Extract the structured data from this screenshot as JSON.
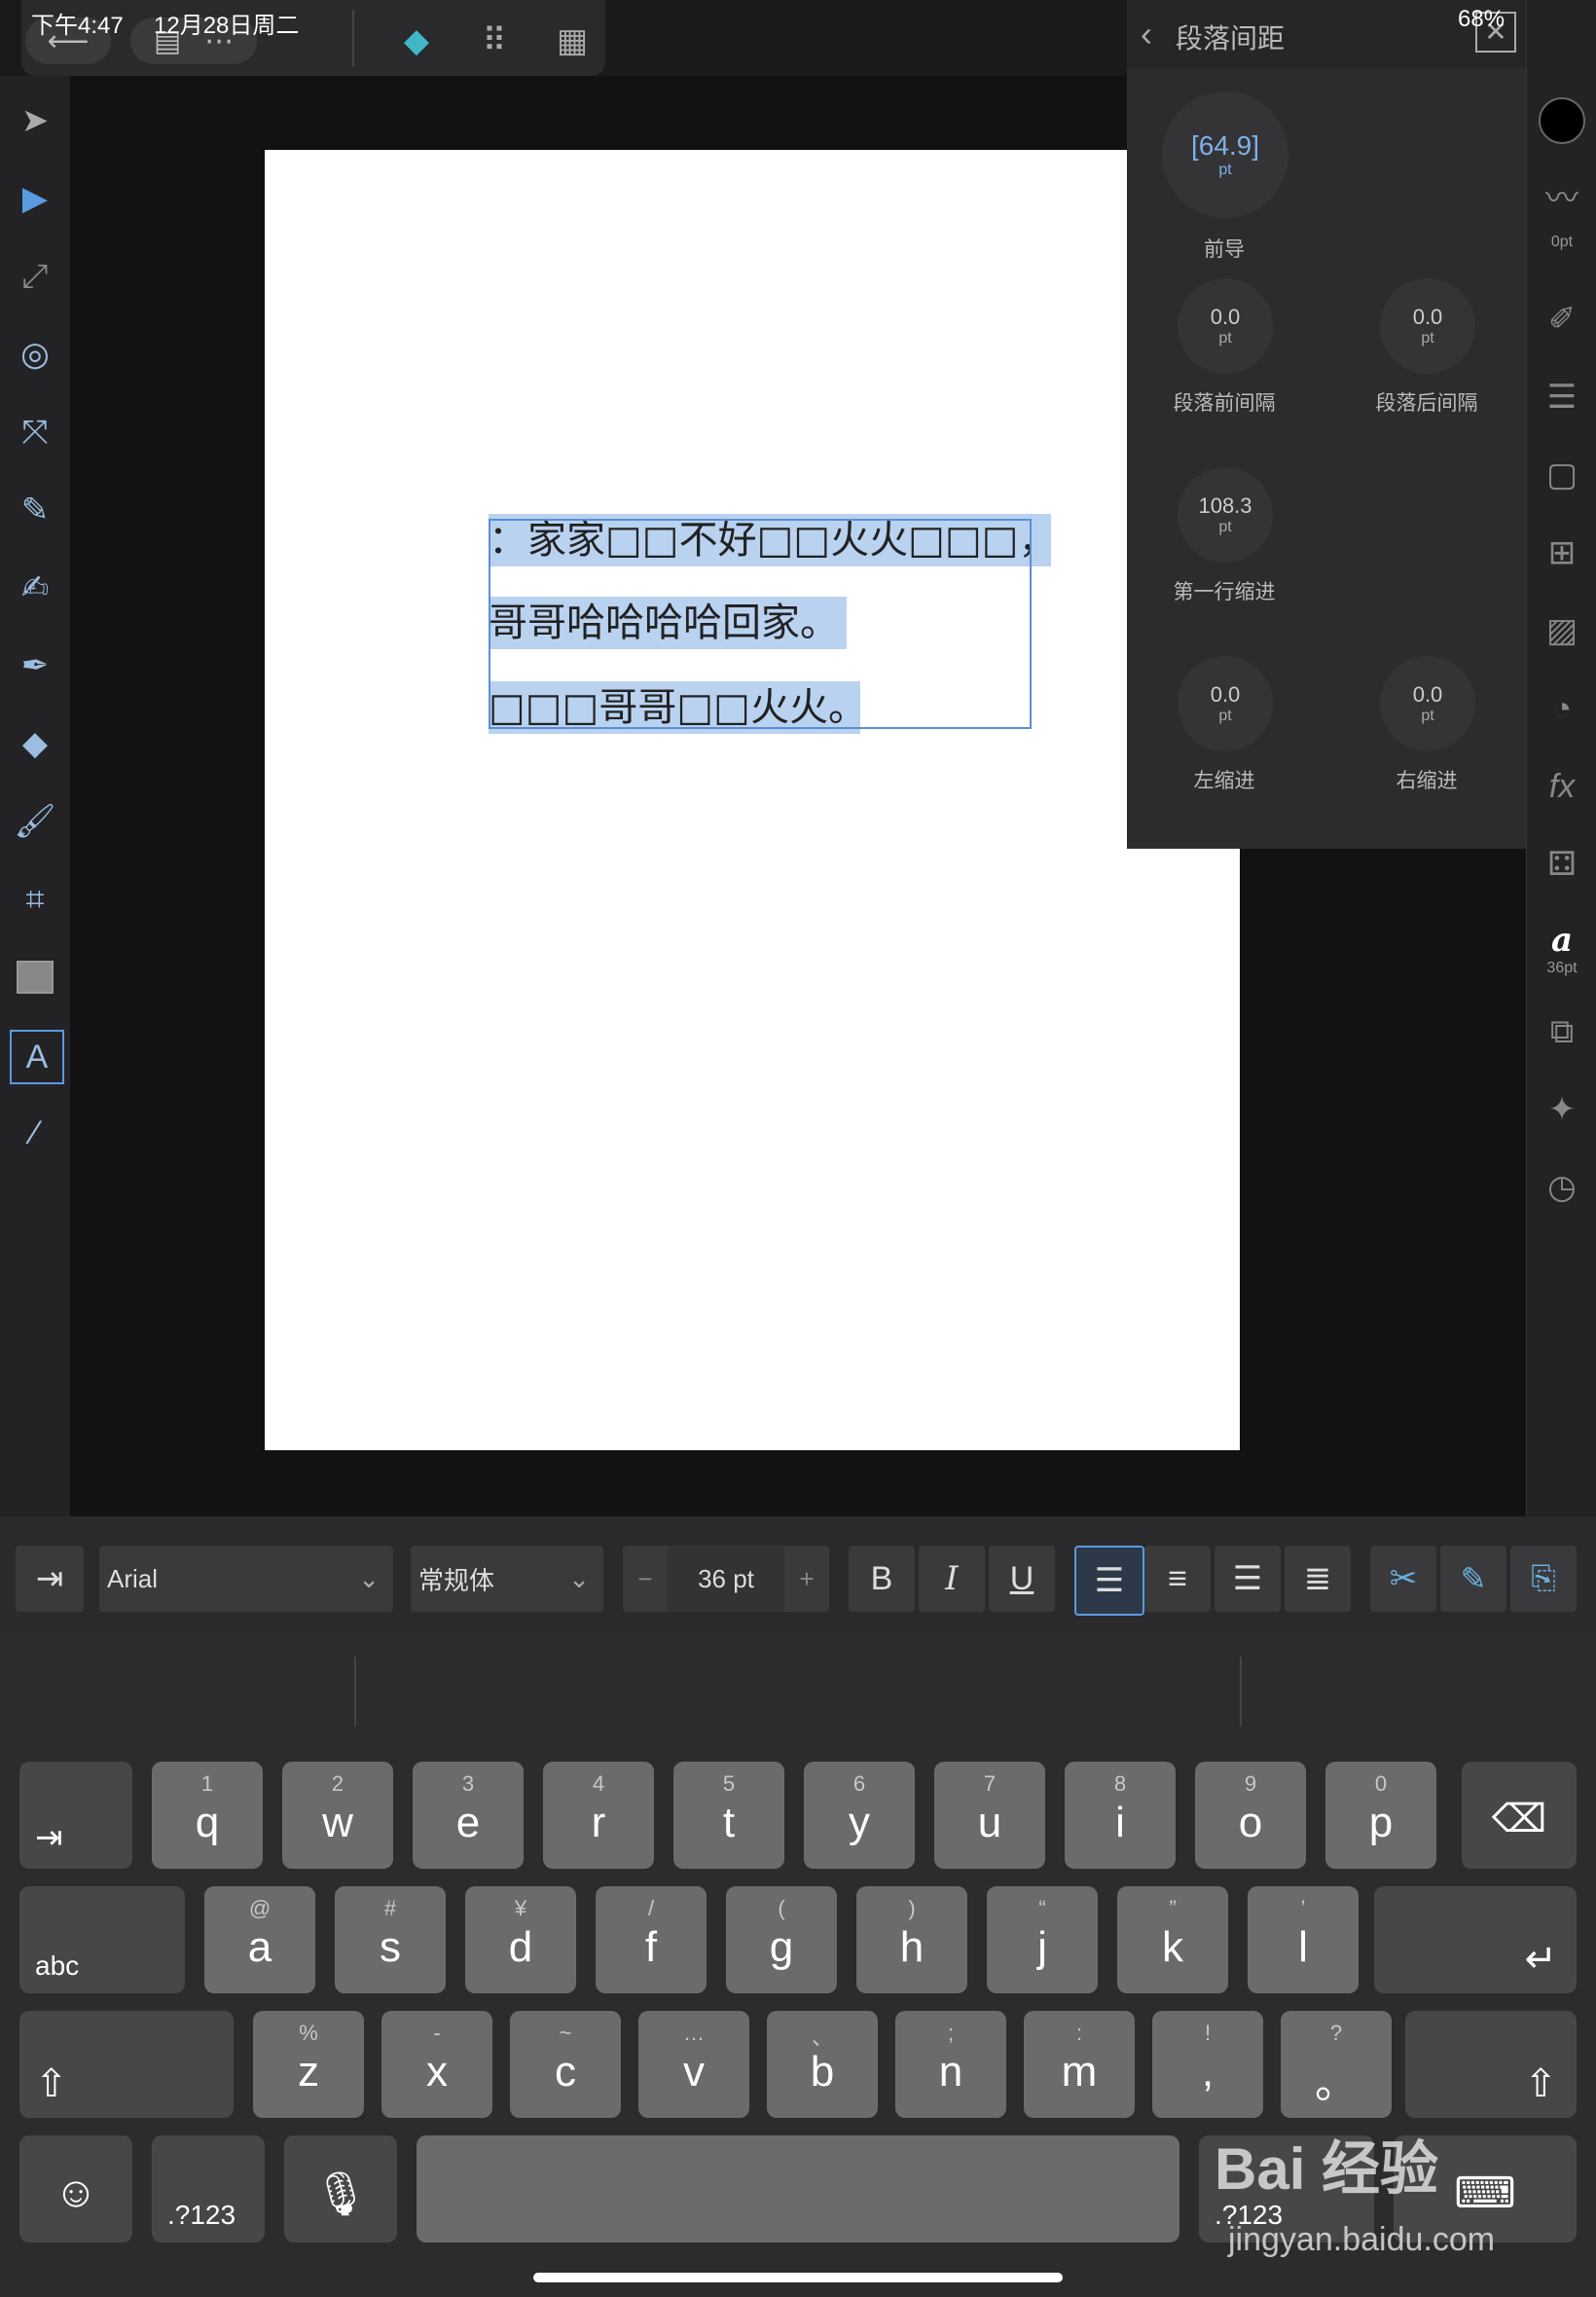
{
  "status": {
    "time": "下午4:47",
    "date": "12月28日周二",
    "battery": "68%"
  },
  "toolbar": {
    "back": "⟵",
    "doc": "▤",
    "more": "⋯"
  },
  "document": {
    "lines": [
      "：家家□□不好□□火火□□□，",
      "哥哥哈哈哈哈回家。",
      "□□□哥哥□□火火。"
    ]
  },
  "panel": {
    "title": "段落间距",
    "leading": {
      "value": "[64.9]",
      "unit": "pt",
      "label": "前导"
    },
    "space_before": {
      "value": "0.0",
      "unit": "pt",
      "label": "段落前间隔"
    },
    "space_after": {
      "value": "0.0",
      "unit": "pt",
      "label": "段落后间隔"
    },
    "first_indent": {
      "value": "108.3",
      "unit": "pt",
      "label": "第一行缩进"
    },
    "left_indent": {
      "value": "0.0",
      "unit": "pt",
      "label": "左缩进"
    },
    "right_indent": {
      "value": "0.0",
      "unit": "pt",
      "label": "右缩进"
    }
  },
  "studio": {
    "stroke_width": "0pt",
    "font_size": "36pt"
  },
  "format": {
    "font": "Arial",
    "style": "常规体",
    "size": "36 pt",
    "minus": "−",
    "plus": "+",
    "bold": "B",
    "italic": "I",
    "underline": "U"
  },
  "keyboard": {
    "row1": [
      {
        "h": "1",
        "c": "q"
      },
      {
        "h": "2",
        "c": "w"
      },
      {
        "h": "3",
        "c": "e"
      },
      {
        "h": "4",
        "c": "r"
      },
      {
        "h": "5",
        "c": "t"
      },
      {
        "h": "6",
        "c": "y"
      },
      {
        "h": "7",
        "c": "u"
      },
      {
        "h": "8",
        "c": "i"
      },
      {
        "h": "9",
        "c": "o"
      },
      {
        "h": "0",
        "c": "p"
      }
    ],
    "row2": [
      {
        "h": "@",
        "c": "a"
      },
      {
        "h": "#",
        "c": "s"
      },
      {
        "h": "¥",
        "c": "d"
      },
      {
        "h": "/",
        "c": "f"
      },
      {
        "h": "(",
        "c": "g"
      },
      {
        "h": ")",
        "c": "h"
      },
      {
        "h": "“",
        "c": "j"
      },
      {
        "h": "”",
        "c": "k"
      },
      {
        "h": "’",
        "c": "l"
      }
    ],
    "row3": [
      {
        "h": "%",
        "c": "z"
      },
      {
        "h": "-",
        "c": "x"
      },
      {
        "h": "~",
        "c": "c"
      },
      {
        "h": "…",
        "c": "v"
      },
      {
        "h": "、",
        "c": "b"
      },
      {
        "h": ";",
        "c": "n"
      },
      {
        "h": ":",
        "c": "m"
      },
      {
        "h": "!",
        "c": ","
      },
      {
        "h": "?",
        "c": "。"
      }
    ],
    "abc": "abc",
    "num": ".?123"
  },
  "watermark": {
    "text": "Bai 经验",
    "url": "jingyan.baidu.com"
  }
}
